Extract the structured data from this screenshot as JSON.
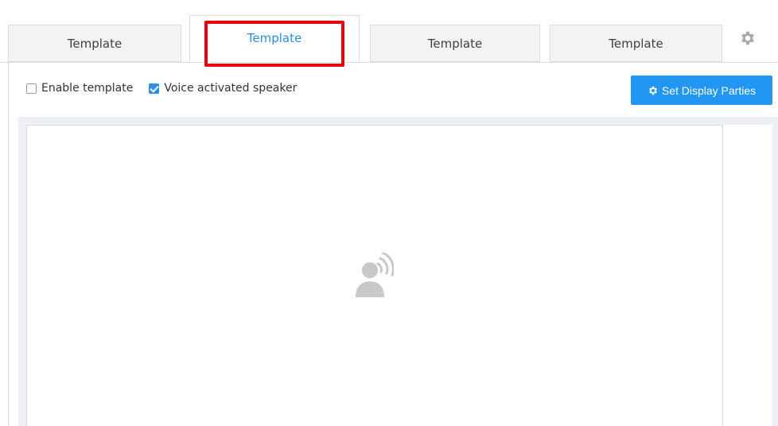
{
  "tabs": [
    {
      "label": "Template",
      "active": false
    },
    {
      "label": "Template",
      "active": true
    },
    {
      "label": "Template",
      "active": false
    },
    {
      "label": "Template",
      "active": false
    }
  ],
  "toolbar": {
    "enable_template_label": "Enable template",
    "enable_template_checked": false,
    "voice_activated_label": "Voice activated speaker",
    "voice_activated_checked": true,
    "set_display_parties_label": "Set Display Parties"
  },
  "icons": {
    "settings": "gear-icon",
    "set_display_parties": "gear-icon",
    "pane_placeholder": "voice-activated-speaker-icon"
  },
  "colors": {
    "accent": "#2196f3",
    "active_tab_text": "#2b8de0",
    "highlight": "#e8000b",
    "icon_gray": "#c8c8c8"
  }
}
